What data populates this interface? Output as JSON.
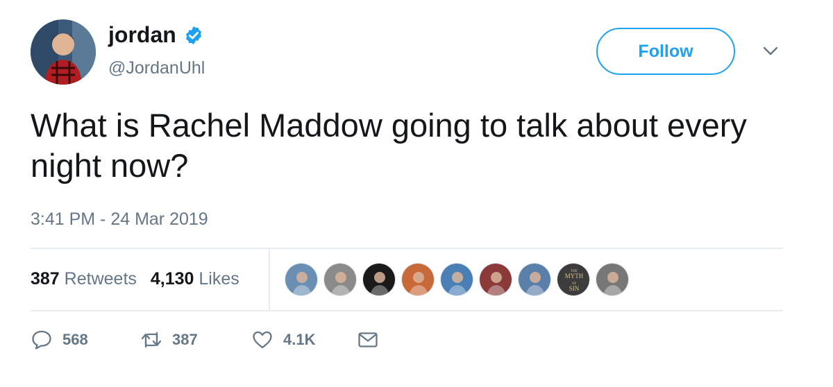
{
  "user": {
    "display_name": "jordan",
    "handle": "@JordanUhl",
    "verified": true
  },
  "header": {
    "follow_label": "Follow",
    "menu_icon": "chevron-down-icon"
  },
  "tweet": {
    "text": "What is Rachel Maddow going to talk about every night now?",
    "timestamp": "3:41 PM - 24 Mar 2019"
  },
  "stats": {
    "retweets_count": "387",
    "retweets_label": "Retweets",
    "likes_count": "4,130",
    "likes_label": "Likes"
  },
  "likers": [
    {
      "name": "liker-avatar-1",
      "color": "#6b8fb3"
    },
    {
      "name": "liker-avatar-2",
      "color": "#8a8a8a"
    },
    {
      "name": "liker-avatar-3",
      "color": "#1a1a1a"
    },
    {
      "name": "liker-avatar-4",
      "color": "#c8693a"
    },
    {
      "name": "liker-avatar-5",
      "color": "#4a7fb5"
    },
    {
      "name": "liker-avatar-6",
      "color": "#8b3a3a"
    },
    {
      "name": "liker-avatar-7",
      "color": "#5a7fa8"
    },
    {
      "name": "liker-avatar-8",
      "color": "#3c3c3c",
      "text_lines": [
        "THE",
        "MYTH",
        "OF",
        "SIN"
      ]
    },
    {
      "name": "liker-avatar-9",
      "color": "#777777"
    }
  ],
  "actions": {
    "replies": "568",
    "retweets": "387",
    "likes": "4.1K"
  },
  "colors": {
    "accent": "#1da1f2",
    "muted": "#657786",
    "text": "#14171a",
    "border": "#e6ecf0"
  }
}
